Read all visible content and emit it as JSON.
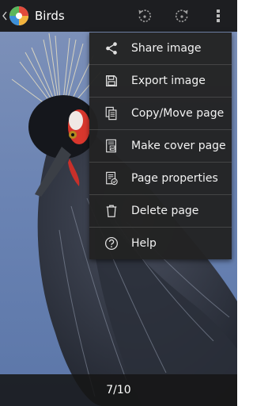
{
  "actionbar": {
    "title": "Birds",
    "icons": {
      "up": "chevron-left-icon",
      "app": "app-logo-icon",
      "rotate_left": "rotate-left-icon",
      "rotate_right": "rotate-right-icon",
      "overflow": "overflow-menu-icon"
    }
  },
  "menu": {
    "items": [
      {
        "label": "Share image",
        "icon": "share-icon"
      },
      {
        "label": "Export image",
        "icon": "save-icon"
      },
      {
        "label": "Copy/Move page",
        "icon": "copy-pages-icon"
      },
      {
        "label": "Make cover page",
        "icon": "cover-page-icon"
      },
      {
        "label": "Page properties",
        "icon": "page-properties-icon"
      },
      {
        "label": "Delete page",
        "icon": "trash-icon"
      },
      {
        "label": "Help",
        "icon": "help-icon"
      }
    ]
  },
  "bottombar": {
    "page_indicator": "7/10"
  },
  "colors": {
    "bar_background": "#161616",
    "menu_background": "#222222",
    "menu_text": "#f2f2f2",
    "photo_sky": "#6d86b4"
  }
}
